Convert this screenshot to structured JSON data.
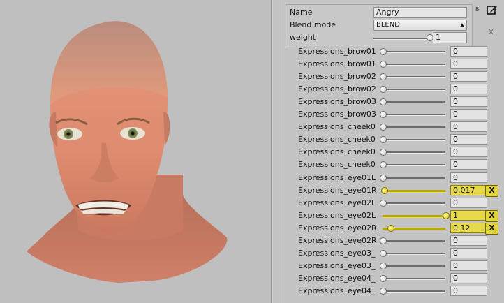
{
  "header": {
    "name_label": "Name",
    "name_value": "Angry",
    "blend_mode_label": "Blend mode",
    "blend_mode_value": "BLEND",
    "weight_label": "weight",
    "weight_value": "1",
    "weight_level": 1.0,
    "corner_letter": "B",
    "close_label": "X",
    "edit_icon": "edit-icon"
  },
  "expressions": [
    {
      "label": "Expressions_brow01",
      "value": "0",
      "level": 0,
      "active": false
    },
    {
      "label": "Expressions_brow01",
      "value": "0",
      "level": 0,
      "active": false
    },
    {
      "label": "Expressions_brow02",
      "value": "0",
      "level": 0,
      "active": false
    },
    {
      "label": "Expressions_brow02",
      "value": "0",
      "level": 0,
      "active": false
    },
    {
      "label": "Expressions_brow03",
      "value": "0",
      "level": 0,
      "active": false
    },
    {
      "label": "Expressions_brow03",
      "value": "0",
      "level": 0,
      "active": false
    },
    {
      "label": "Expressions_cheek0",
      "value": "0",
      "level": 0,
      "active": false
    },
    {
      "label": "Expressions_cheek0",
      "value": "0",
      "level": 0,
      "active": false
    },
    {
      "label": "Expressions_cheek0",
      "value": "0",
      "level": 0,
      "active": false
    },
    {
      "label": "Expressions_cheek0",
      "value": "0",
      "level": 0,
      "active": false
    },
    {
      "label": "Expressions_eye01L",
      "value": "0",
      "level": 0,
      "active": false
    },
    {
      "label": "Expressions_eye01R",
      "value": "0.017",
      "level": 0.017,
      "active": true,
      "reset": "X"
    },
    {
      "label": "Expressions_eye02L",
      "value": "0",
      "level": 0,
      "active": false
    },
    {
      "label": "Expressions_eye02L",
      "value": "1",
      "level": 1.0,
      "active": true,
      "reset": "X"
    },
    {
      "label": "Expressions_eye02R",
      "value": "0.12",
      "level": 0.12,
      "active": true,
      "reset": "X"
    },
    {
      "label": "Expressions_eye02R",
      "value": "0",
      "level": 0,
      "active": false
    },
    {
      "label": "Expressions_eye03_",
      "value": "0",
      "level": 0,
      "active": false
    },
    {
      "label": "Expressions_eye03_",
      "value": "0",
      "level": 0,
      "active": false
    },
    {
      "label": "Expressions_eye04_",
      "value": "0",
      "level": 0,
      "active": false
    },
    {
      "label": "Expressions_eye04_",
      "value": "0",
      "level": 0,
      "active": false
    }
  ]
}
